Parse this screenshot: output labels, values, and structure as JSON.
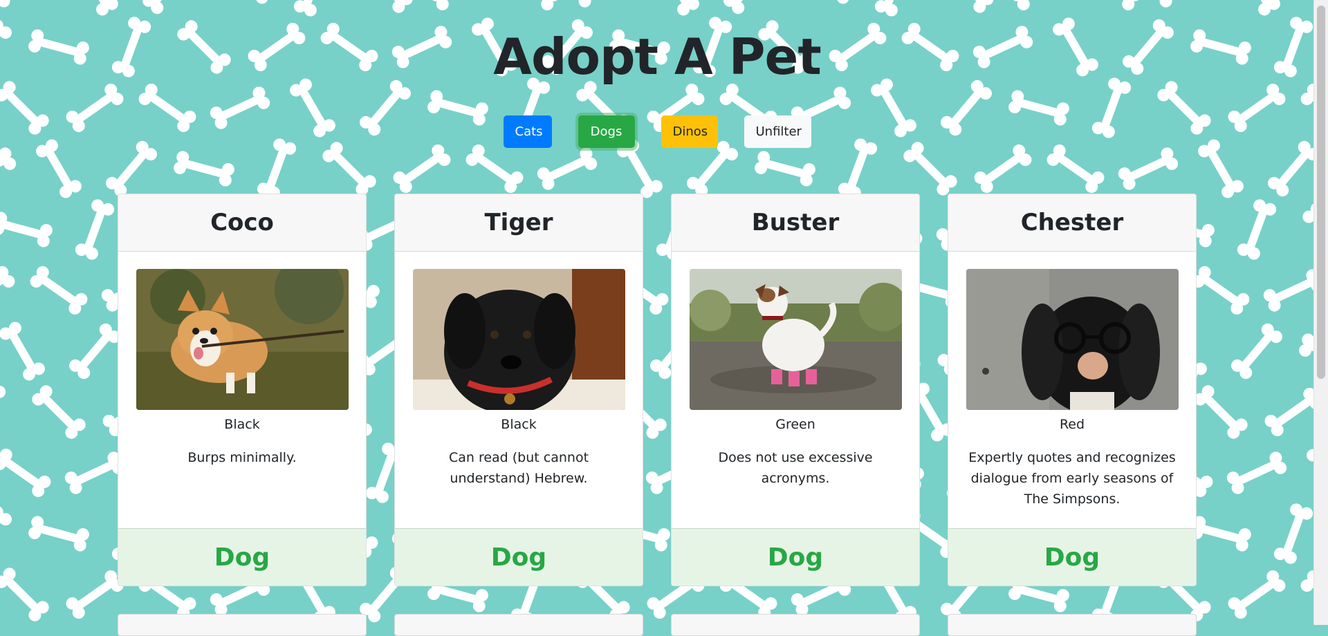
{
  "page": {
    "title": "Adopt A Pet"
  },
  "filters": {
    "cats": "Cats",
    "dogs": "Dogs",
    "dinos": "Dinos",
    "unfilter": "Unfilter"
  },
  "pets": [
    {
      "name": "Coco",
      "color": "Black",
      "description": "Burps minimally.",
      "type": "Dog"
    },
    {
      "name": "Tiger",
      "color": "Black",
      "description": "Can read (but cannot understand) Hebrew.",
      "type": "Dog"
    },
    {
      "name": "Buster",
      "color": "Green",
      "description": "Does not use excessive acronyms.",
      "type": "Dog"
    },
    {
      "name": "Chester",
      "color": "Red",
      "description": "Expertly quotes and recognizes dialogue from early seasons of The Simpsons.",
      "type": "Dog"
    }
  ],
  "theme": {
    "background": "#77d1c8",
    "bone": "#ffffff",
    "accent_green": "#28a745",
    "accent_blue": "#007bff",
    "accent_yellow": "#ffc107"
  }
}
